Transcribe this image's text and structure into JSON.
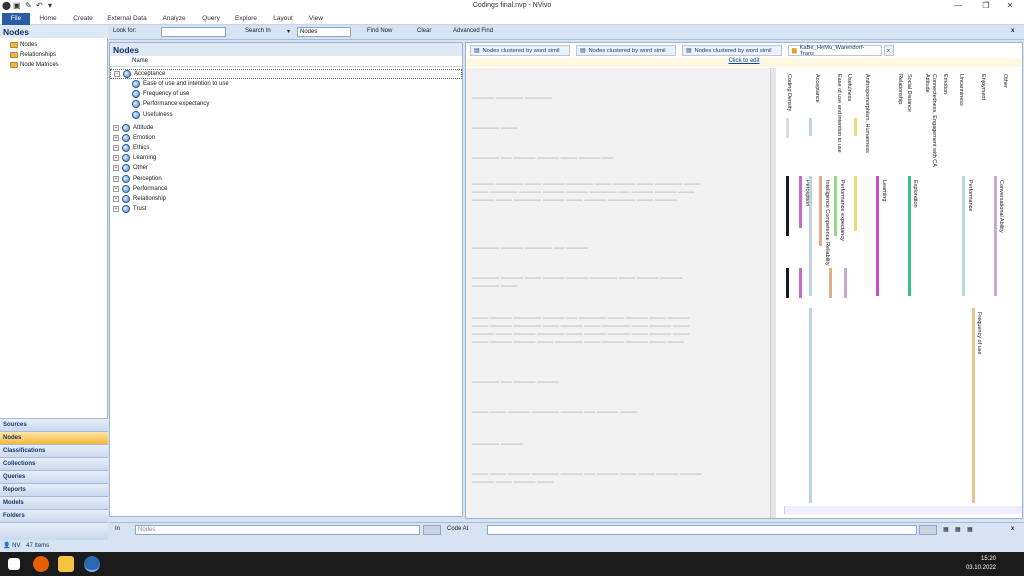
{
  "window": {
    "title": "Codings final.nvp - NVivo"
  },
  "ribbon": {
    "tabs": [
      "File",
      "Home",
      "Create",
      "External Data",
      "Analyze",
      "Query",
      "Explore",
      "Layout",
      "View"
    ]
  },
  "nav": {
    "title": "Nodes",
    "tree": [
      "Nodes",
      "Relationships",
      "Node Matrices"
    ],
    "buttons": [
      "Sources",
      "Nodes",
      "Classifications",
      "Collections",
      "Queries",
      "Reports",
      "Models",
      "Folders"
    ]
  },
  "findbar": {
    "look_for": "Look for:",
    "search_in": "Search In",
    "search_value": "Nodes",
    "find_now": "Find Now",
    "clear": "Clear",
    "advanced": "Advanced Find",
    "close": "x"
  },
  "nodes": {
    "title": "Nodes",
    "col_name": "Name",
    "rows": [
      {
        "label": "Acceptance",
        "level": 0,
        "exp": "−"
      },
      {
        "label": "Ease of use and intention to use",
        "level": 1
      },
      {
        "label": "Frequency of use",
        "level": 1
      },
      {
        "label": "Performance expectancy",
        "level": 1
      },
      {
        "label": "Usefulness",
        "level": 1
      },
      {
        "label": "Attitude",
        "level": 0,
        "exp": "+"
      },
      {
        "label": "Emotion",
        "level": 0,
        "exp": "+"
      },
      {
        "label": "Ethics",
        "level": 0,
        "exp": "+"
      },
      {
        "label": "Learning",
        "level": 0,
        "exp": "+"
      },
      {
        "label": "Other",
        "level": 0,
        "exp": "+"
      },
      {
        "label": "Perception",
        "level": 0,
        "exp": "+"
      },
      {
        "label": "Performance",
        "level": 0,
        "exp": "+"
      },
      {
        "label": "Relationship",
        "level": 0,
        "exp": "+"
      },
      {
        "label": "Trust",
        "level": 0,
        "exp": "+"
      }
    ]
  },
  "detail": {
    "tabs": [
      "Nodes clustered by word simil",
      "Nodes clustered by word simil",
      "Nodes clustered by word simil",
      "KaBe_HeMu_Warendorf-Trans"
    ],
    "close_tab": "x",
    "click_to_edit": "Click to edit",
    "stripe_labels": [
      "Coding Density",
      "Acceptance",
      "Ease of use and intention to use",
      "Usefulness",
      "Anthropomorphism, Humanness",
      "Relationship",
      "Social Distance",
      "Attitude",
      "Connectedness, Engagement with CA",
      "Emotion",
      "Uncanniness",
      "Enjoyment",
      "Other"
    ],
    "lower_labels": [
      "Perception",
      "Intelligence Competence Reliability",
      "Performance expectancy",
      "Learning",
      "Exploration",
      "Performance",
      "Conversational Ability",
      "Frequency of use"
    ]
  },
  "bottombar": {
    "in_label": "In",
    "in_value": "Nodes",
    "code_at": "Code At",
    "close": "x"
  },
  "status": {
    "user": "NV",
    "items": "47 Items"
  },
  "taskbar": {
    "time": "15:20",
    "date": "03.10.2022"
  }
}
